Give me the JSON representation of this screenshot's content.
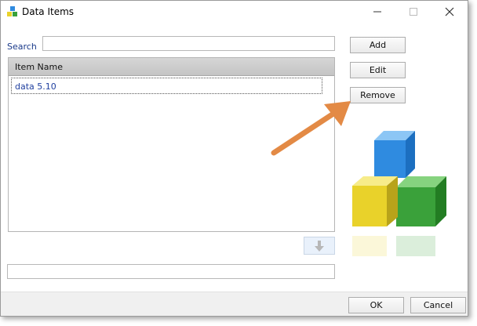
{
  "window": {
    "title": "Data Items",
    "controls": {
      "minimize": "minimize",
      "maximize": "maximize",
      "close": "close"
    }
  },
  "search": {
    "label": "Search",
    "value": ""
  },
  "list": {
    "header": "Item Name",
    "items": [
      {
        "label": "data 5.10"
      }
    ]
  },
  "buttons": {
    "add": "Add",
    "edit": "Edit",
    "remove": "Remove"
  },
  "footer": {
    "ok": "OK",
    "cancel": "Cancel"
  },
  "bottom_field": {
    "value": ""
  },
  "colors": {
    "arrow": "#e38a45",
    "cube_blue": "#2f8be0",
    "cube_yellow": "#e9d22a",
    "cube_green": "#3aa13a",
    "link_text": "#1f3f9f"
  },
  "icons": {
    "app": "data-items-app-icon",
    "down": "arrow-down-icon",
    "arrow": "annotation-arrow"
  }
}
